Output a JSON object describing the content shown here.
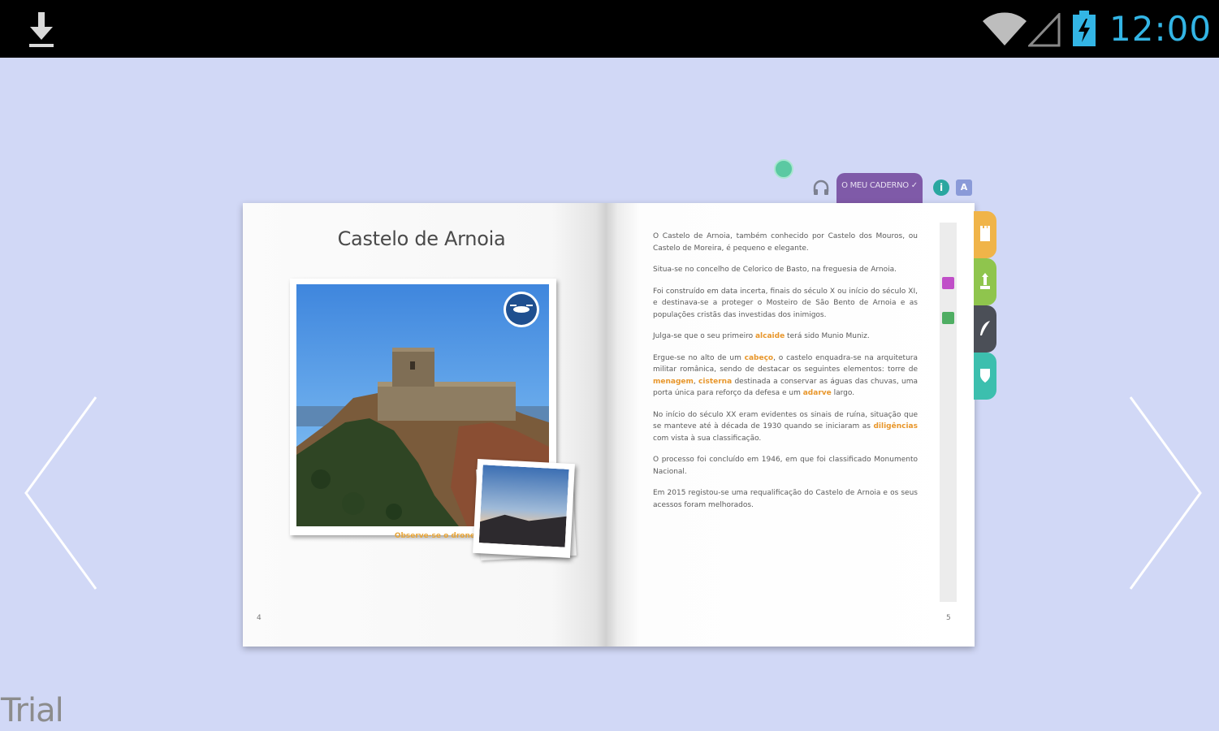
{
  "status_bar": {
    "time": "12:00",
    "icons": [
      "download-icon",
      "wifi-icon",
      "signal-icon",
      "battery-icon"
    ],
    "clock_color": "#33b5e5"
  },
  "toolbar": {
    "caderno_label": "O MEU CADERNO ✓",
    "info_label": "i",
    "font_label": "A",
    "icons": [
      "share-icon",
      "headphone-icon",
      "info-icon",
      "font-icon"
    ]
  },
  "book": {
    "left_page": {
      "title": "Castelo de Arnoia",
      "caption": "Observe-se o drone",
      "page_number": "4",
      "badge_icon": "drone-icon"
    },
    "right_page": {
      "page_number": "5",
      "paragraphs": [
        [
          {
            "t": "O Castelo de Arnoia, também conhecido por Castelo dos Mouros, ou Castelo de Moreira, é pequeno e elegante."
          }
        ],
        [
          {
            "t": "Situa-se no concelho de Celorico de Basto, na freguesia de Arnoia."
          }
        ],
        [
          {
            "t": "Foi construído em data incerta, finais do século X ou início do século XI, e destinava-se a proteger o Mosteiro de São Bento de Arnoia e as populações cristãs das investidas dos inimigos."
          }
        ],
        [
          {
            "t": "Julga-se que o seu primeiro "
          },
          {
            "t": "alcaide",
            "hl": true
          },
          {
            "t": " terá sido Munio Muniz."
          }
        ],
        [
          {
            "t": "Ergue-se no alto de um "
          },
          {
            "t": "cabeço",
            "hl": true
          },
          {
            "t": ", o castelo enquadra-se na arquitetura militar românica, sendo de destacar os seguintes elementos: torre de "
          },
          {
            "t": "menagem",
            "hl": true
          },
          {
            "t": ", "
          },
          {
            "t": "cisterna",
            "hl": true
          },
          {
            "t": " destinada a conservar as águas das chuvas, uma porta única para reforço da defesa e um "
          },
          {
            "t": "adarve",
            "hl": true
          },
          {
            "t": " largo."
          }
        ],
        [
          {
            "t": "No início do século XX eram evidentes os sinais de ruína, situação que se manteve até à década de 1930 quando se iniciaram as "
          },
          {
            "t": "diligências",
            "hl": true
          },
          {
            "t": " com vista à sua classificação."
          }
        ],
        [
          {
            "t": "O processo foi concluído em 1946, em que foi classificado Monumento Nacional."
          }
        ],
        [
          {
            "t": "Em 2015 registou-se uma requalificação do Castelo de Arnoia e os seus acessos foram melhorados."
          }
        ]
      ],
      "highlight_color": "#e8962a"
    },
    "side_tabs": [
      {
        "name": "castle-tab",
        "color": "#f0b449"
      },
      {
        "name": "monument-tab",
        "color": "#8fc54d"
      },
      {
        "name": "quill-tab",
        "color": "#4b4f57"
      },
      {
        "name": "shield-tab",
        "color": "#3cbfae"
      }
    ]
  },
  "navigation": {
    "prev_icon": "chevron-left-icon",
    "next_icon": "chevron-right-icon"
  },
  "watermark": {
    "label": "Trial"
  }
}
